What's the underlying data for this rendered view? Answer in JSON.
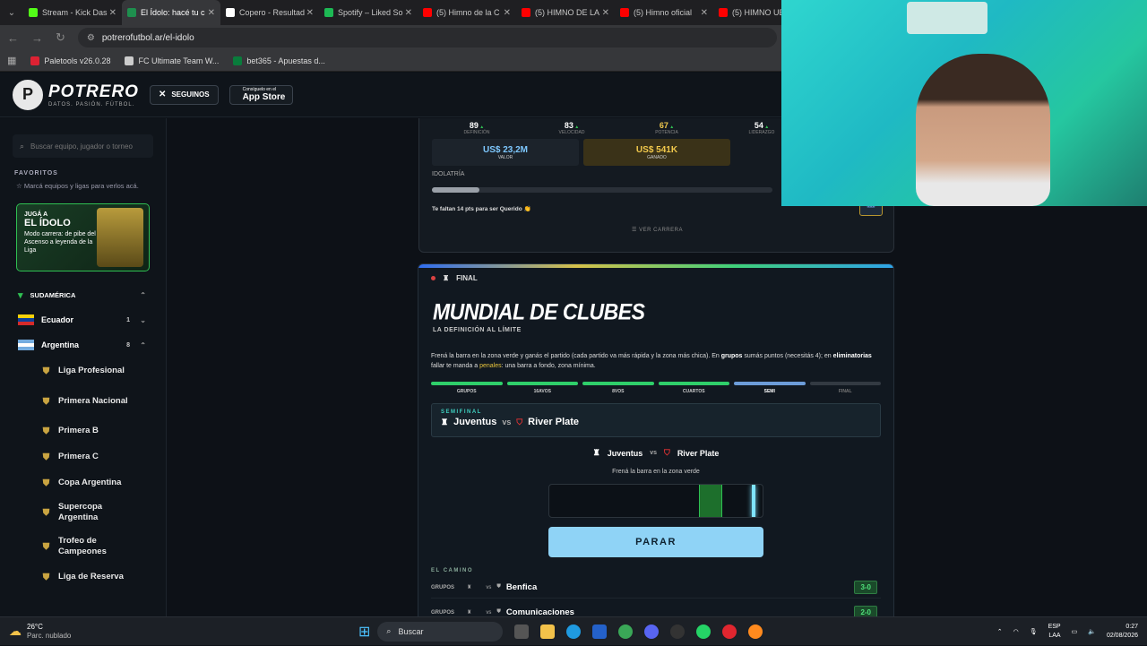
{
  "browser": {
    "tabs": [
      {
        "label": "Stream - Kick Das",
        "color": "#53fc18",
        "active": false
      },
      {
        "label": "El Ídolo: hacé tu c",
        "color": "#1e8f4e",
        "active": true
      },
      {
        "label": "Copero - Resultad",
        "color": "#ffffff",
        "active": false
      },
      {
        "label": "Spotify – Liked So",
        "color": "#1db954",
        "active": false
      },
      {
        "label": "(5) Himno de la C",
        "color": "#ff0000",
        "active": false
      },
      {
        "label": "(5) HIMNO DE LA",
        "color": "#ff0000",
        "active": false
      },
      {
        "label": "(5) Himno oficial",
        "color": "#ff0000",
        "active": false
      },
      {
        "label": "(5) HIMNO UE",
        "color": "#ff0000",
        "active": false
      }
    ],
    "url": "potrerofutbol.ar/el-idolo",
    "bookmarks": [
      {
        "label": "Paletools v26.0.28",
        "color": "#d23"
      },
      {
        "label": "FC Ultimate Team W...",
        "color": "#ccc"
      },
      {
        "label": "bet365 - Apuestas d...",
        "color": "#0a7c3c"
      }
    ]
  },
  "header": {
    "brand": "POTRERO",
    "tagline": "DATOS. PASIÓN. FÚTBOL.",
    "follow_label": "SEGUINOS",
    "store_small": "Consíguelo en el",
    "store_big": "App Store"
  },
  "sidebar": {
    "search_placeholder": "Buscar equipo, jugador o torneo",
    "favorites_heading": "FAVORITOS",
    "favorites_note": "Marcá equipos y ligas para verlos acá.",
    "promo": {
      "l1": "JUGÁ A",
      "l2": "EL ÍDOLO",
      "l3": "Modo carrera: de pibe del Ascenso a leyenda de la Liga"
    },
    "region": "SUDAMÉRICA",
    "countries": [
      {
        "name": "Ecuador",
        "count": "1",
        "chevron": "⌄"
      },
      {
        "name": "Argentina",
        "count": "8",
        "chevron": "⌃"
      }
    ],
    "leagues": [
      "Liga Profesional",
      "Primera Nacional",
      "Primera B",
      "Primera C",
      "Copa Argentina",
      "Supercopa Argentina",
      "Trofeo de Campeones",
      "Liga de Reserva"
    ]
  },
  "career": {
    "stats": [
      {
        "value": "89",
        "label": "DEFINICIÓN"
      },
      {
        "value": "83",
        "label": "VELOCIDAD"
      },
      {
        "value": "67",
        "label": "POTENCIA"
      },
      {
        "value": "54",
        "label": "LIDERAZGO"
      }
    ],
    "value_amount": "US$ 23,2M",
    "value_label": "VALOR",
    "earned_amount": "US$ 541K",
    "earned_label": "GANADO",
    "idolatry_label": "IDOLATRÍA",
    "idolatry_progress": 0.14,
    "idolatry_note": "Te faltan 14 pts para ser Querido 👏",
    "career_link": "VER CARRERA"
  },
  "final": {
    "tag": "FINAL",
    "title": "MUNDIAL DE CLUBES",
    "subtitle": "LA DEFINICIÓN AL LÍMITE",
    "desc_a": "Frená la barra en la zona verde y ganás el partido (cada partido va más rápida y la zona más chica). En ",
    "desc_b": "grupos",
    "desc_c": " sumás puntos (necesitás 4); en ",
    "desc_d": "eliminatorias",
    "desc_e": " fallar te manda a ",
    "desc_f": "penales",
    "desc_g": ": una barra a fondo, zona mínima.",
    "steps": [
      {
        "label": "GRUPOS",
        "color": "#2fcf6a"
      },
      {
        "label": "16AVOS",
        "color": "#2fcf6a"
      },
      {
        "label": "8VOS",
        "color": "#2fcf6a"
      },
      {
        "label": "CUARTOS",
        "color": "#2fcf6a"
      },
      {
        "label": "SEMI",
        "color": "#6c9cd8"
      },
      {
        "label": "FINAL",
        "color": "#333a42"
      }
    ],
    "semi_label": "SEMIFINAL",
    "home": "Juventus",
    "away": "River Plate",
    "vs": "vs",
    "hint": "Frená la barra en la zona verde",
    "zone_start": 0.7,
    "zone_end": 0.81,
    "needle_pos": 0.96,
    "stop_label": "PARAR",
    "path_label": "EL CAMINO",
    "path": [
      {
        "phase": "GRUPOS",
        "rival": "Benfica",
        "score": "3-0"
      },
      {
        "phase": "GRUPOS",
        "rival": "Comunicaciones",
        "score": "2-0"
      }
    ]
  },
  "taskbar": {
    "temp": "26°C",
    "weather": "Parc. nublado",
    "search": "Buscar",
    "lang1": "ESP",
    "lang2": "LAA",
    "time": "0:27",
    "date": "02/08/2026"
  }
}
